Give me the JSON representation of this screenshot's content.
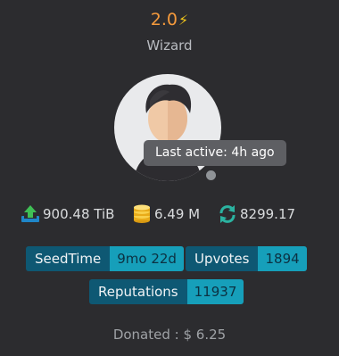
{
  "header": {
    "version": "2.0",
    "version_icon": "bolt-icon",
    "role": "Wizard"
  },
  "avatar": {
    "tooltip": "Last active: 4h ago",
    "status_icon": "offline-dot"
  },
  "stats": {
    "upload": {
      "icon": "upload-icon",
      "value": "900.48 TiB"
    },
    "coins": {
      "icon": "coins-icon",
      "value": "6.49 M"
    },
    "ratio": {
      "icon": "sync-icon",
      "value": "8299.17"
    }
  },
  "badges": [
    {
      "label": "SeedTime",
      "value": "9mo 22d"
    },
    {
      "label": "Upvotes",
      "value": "1894"
    },
    {
      "label": "Reputations",
      "value": "11937"
    }
  ],
  "donation": "Donated : $ 6.25",
  "colors": {
    "background": "#2c2c2f",
    "accent_orange": "#f59a3c",
    "badge_key": "#0e5873",
    "badge_value": "#169fba"
  }
}
